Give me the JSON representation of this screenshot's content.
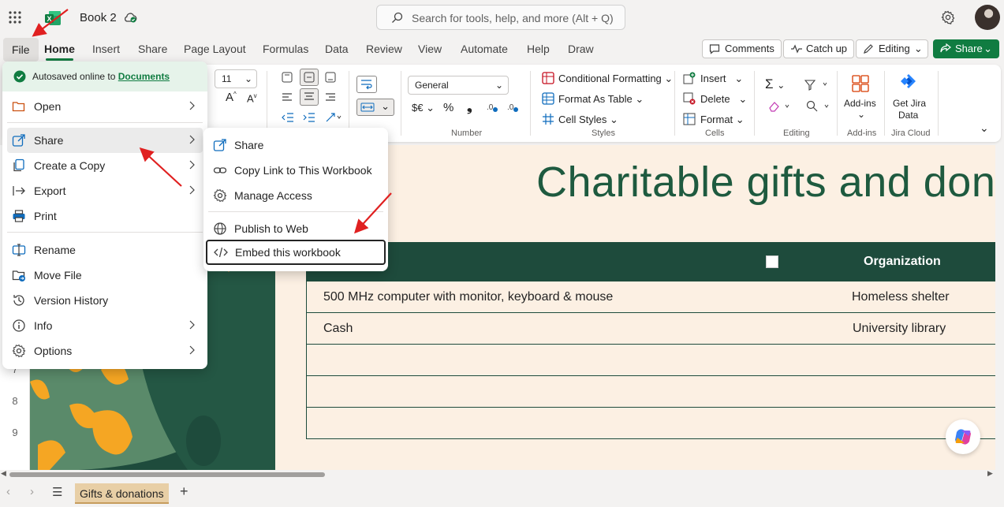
{
  "app": {
    "doc_title": "Book 2",
    "search_placeholder": "Search for tools, help, and more (Alt + Q)"
  },
  "tabs": [
    "File",
    "Home",
    "Insert",
    "Share",
    "Page Layout",
    "Formulas",
    "Data",
    "Review",
    "View",
    "Automate",
    "Help",
    "Draw"
  ],
  "header_buttons": {
    "comments": "Comments",
    "catch_up": "Catch up",
    "editing": "Editing",
    "share": "Share"
  },
  "ribbon": {
    "font_size": "11",
    "number_format": "General",
    "currency_label": "$€",
    "conditional_formatting": "Conditional Formatting",
    "format_as_table": "Format As Table",
    "cell_styles": "Cell Styles",
    "insert": "Insert",
    "delete": "Delete",
    "format": "Format",
    "add_ins": "Add-ins",
    "get_jira_line1": "Get Jira",
    "get_jira_line2": "Data",
    "groups": {
      "number": "Number",
      "styles": "Styles",
      "cells": "Cells",
      "editing": "Editing",
      "add_ins": "Add-ins",
      "jira_cloud": "Jira Cloud"
    }
  },
  "file_menu": {
    "autosave_text": "Autosaved online to",
    "autosave_link": "Documents",
    "items": {
      "open": "Open",
      "share": "Share",
      "create_copy": "Create a Copy",
      "export": "Export",
      "print": "Print",
      "rename": "Rename",
      "move_file": "Move File",
      "version_history": "Version History",
      "info": "Info",
      "options": "Options"
    }
  },
  "share_submenu": {
    "share": "Share",
    "copy_link": "Copy Link to This Workbook",
    "manage_access": "Manage Access",
    "publish_web": "Publish to Web",
    "embed": "Embed this workbook"
  },
  "sheet": {
    "title": "Charitable gifts and dona",
    "column_org": "Organization",
    "rows": [
      {
        "item": "500 MHz computer with monitor, keyboard & mouse",
        "org": "Homeless shelter"
      },
      {
        "item": "Cash",
        "org": "University library"
      }
    ],
    "row_numbers": [
      "7",
      "8",
      "9"
    ],
    "sheet_tab": "Gifts & donations"
  },
  "colors": {
    "accent": "#107c41",
    "header_green": "#1e4b3c",
    "banner_bg": "#fcf0e3",
    "annotation_red": "#e02020"
  }
}
